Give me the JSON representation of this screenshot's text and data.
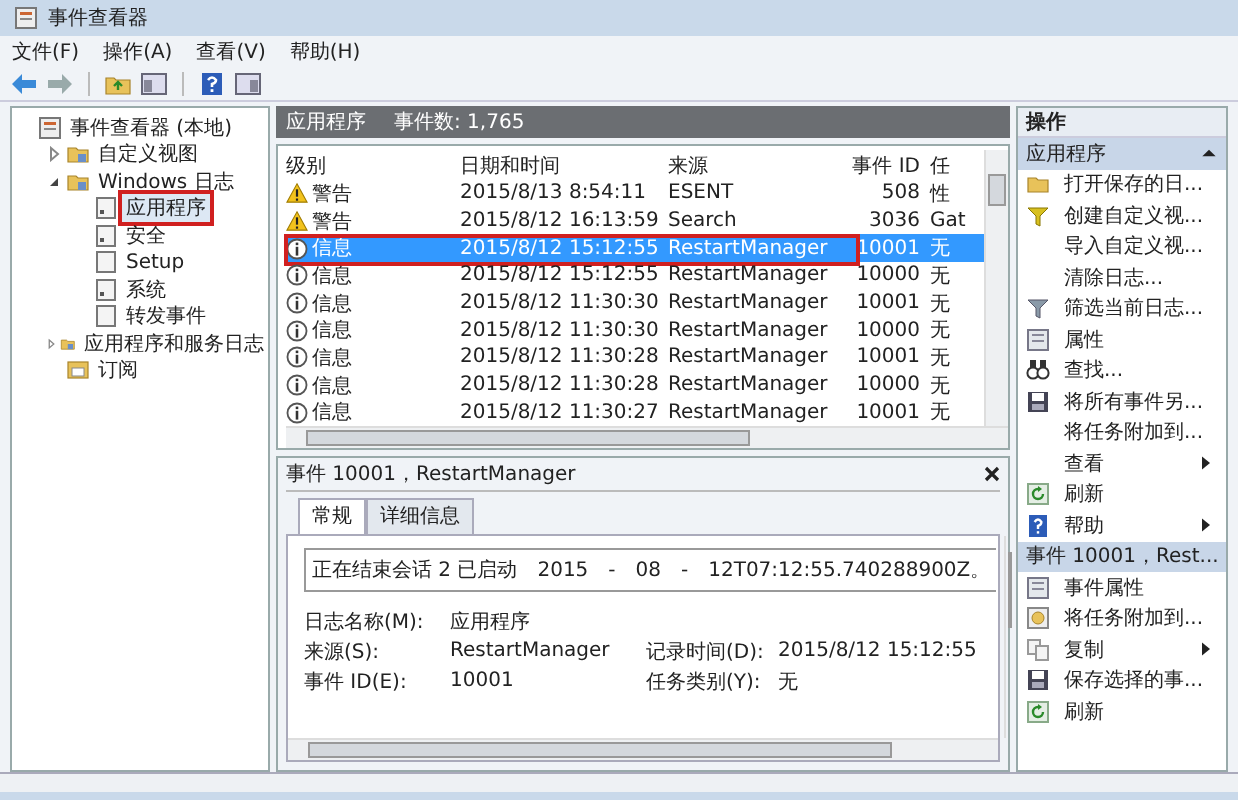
{
  "window": {
    "title": "事件查看器"
  },
  "menu": [
    {
      "label": "文件(F)"
    },
    {
      "label": "操作(A)"
    },
    {
      "label": "查看(V)"
    },
    {
      "label": "帮助(H)"
    }
  ],
  "tree": [
    {
      "label": "事件查看器 (本地)",
      "kind": "root",
      "selected": false,
      "outlined": false,
      "children": [
        {
          "label": "自定义视图",
          "kind": "folder",
          "expanded": false,
          "selected": false,
          "outlined": false
        },
        {
          "label": "Windows 日志",
          "kind": "folder",
          "expanded": true,
          "selected": false,
          "outlined": false,
          "children": [
            {
              "label": "应用程序",
              "kind": "log",
              "selected": true,
              "outlined": true
            },
            {
              "label": "安全",
              "kind": "log",
              "selected": false,
              "outlined": false
            },
            {
              "label": "Setup",
              "kind": "blank",
              "selected": false,
              "outlined": false
            },
            {
              "label": "系统",
              "kind": "log",
              "selected": false,
              "outlined": false
            },
            {
              "label": "转发事件",
              "kind": "blank",
              "selected": false,
              "outlined": false
            }
          ]
        },
        {
          "label": "应用程序和服务日志",
          "kind": "folder",
          "expanded": false,
          "selected": false,
          "outlined": false
        },
        {
          "label": "订阅",
          "kind": "sub",
          "selected": false,
          "outlined": false
        }
      ]
    }
  ],
  "log_header": {
    "name": "应用程序",
    "count": "事件数: 1,765"
  },
  "table": {
    "columns": [
      "级别",
      "日期和时间",
      "来源",
      "事件 ID",
      "任"
    ],
    "rows": [
      {
        "kind": "warning",
        "level": "警告",
        "time": "2015/8/13 8:54:11",
        "source": "ESENT",
        "id": "508",
        "task": "性",
        "selected": false,
        "outlined": false
      },
      {
        "kind": "warning",
        "level": "警告",
        "time": "2015/8/12 16:13:59",
        "source": "Search",
        "id": "3036",
        "task": "Gat",
        "selected": false,
        "outlined": false
      },
      {
        "kind": "info",
        "level": "信息",
        "time": "2015/8/12 15:12:55",
        "source": "RestartManager",
        "id": "10001",
        "task": "无",
        "selected": true,
        "outlined": true
      },
      {
        "kind": "info",
        "level": "信息",
        "time": "2015/8/12 15:12:55",
        "source": "RestartManager",
        "id": "10000",
        "task": "无",
        "selected": false,
        "outlined": false
      },
      {
        "kind": "info",
        "level": "信息",
        "time": "2015/8/12 11:30:30",
        "source": "RestartManager",
        "id": "10001",
        "task": "无",
        "selected": false,
        "outlined": false
      },
      {
        "kind": "info",
        "level": "信息",
        "time": "2015/8/12 11:30:30",
        "source": "RestartManager",
        "id": "10000",
        "task": "无",
        "selected": false,
        "outlined": false
      },
      {
        "kind": "info",
        "level": "信息",
        "time": "2015/8/12 11:30:28",
        "source": "RestartManager",
        "id": "10001",
        "task": "无",
        "selected": false,
        "outlined": false
      },
      {
        "kind": "info",
        "level": "信息",
        "time": "2015/8/12 11:30:28",
        "source": "RestartManager",
        "id": "10000",
        "task": "无",
        "selected": false,
        "outlined": false
      },
      {
        "kind": "info",
        "level": "信息",
        "time": "2015/8/12 11:30:27",
        "source": "RestartManager",
        "id": "10001",
        "task": "无",
        "selected": false,
        "outlined": false
      }
    ]
  },
  "detail": {
    "title": "事件 10001，RestartManager",
    "tabs": [
      {
        "label": "常规",
        "selected": true
      },
      {
        "label": "详细信息",
        "selected": false
      }
    ],
    "message": "正在结束会话 2 已启动　2015　-　08　-　12T07:12:55.740288900Z。",
    "fields": [
      {
        "label": "日志名称(M):",
        "value": "应用程序"
      },
      {
        "label": "来源(S):",
        "value": "RestartManager",
        "label2": "记录时间(D):",
        "value2": "2015/8/12 15:12:55"
      },
      {
        "label": "事件 ID(E):",
        "value": "10001",
        "label2": "任务类别(Y):",
        "value2": "无"
      }
    ]
  },
  "actions": {
    "title": "操作",
    "sections": [
      {
        "title": "应用程序",
        "expanded": true,
        "items": [
          {
            "label": "打开保存的日...",
            "kind": "folder"
          },
          {
            "label": "创建自定义视...",
            "kind": "filter"
          },
          {
            "label": "导入自定义视...",
            "kind": "none"
          },
          {
            "label": "清除日志...",
            "kind": "none"
          },
          {
            "label": "筛选当前日志...",
            "kind": "filter2"
          },
          {
            "label": "属性",
            "kind": "props"
          },
          {
            "label": "查找...",
            "kind": "find"
          },
          {
            "label": "将所有事件另...",
            "kind": "save"
          },
          {
            "label": "将任务附加到...",
            "kind": "none"
          },
          {
            "label": "查看",
            "kind": "none",
            "submenu": true
          },
          {
            "label": "刷新",
            "kind": "refresh"
          },
          {
            "label": "帮助",
            "kind": "help",
            "submenu": true
          }
        ]
      },
      {
        "title": "事件 10001，Rest...",
        "expanded": true,
        "items": [
          {
            "label": "事件属性",
            "kind": "props"
          },
          {
            "label": "将任务附加到...",
            "kind": "task"
          },
          {
            "label": "复制",
            "kind": "copy",
            "submenu": true
          },
          {
            "label": "保存选择的事...",
            "kind": "save"
          },
          {
            "label": "刷新",
            "kind": "refresh"
          }
        ]
      }
    ]
  }
}
